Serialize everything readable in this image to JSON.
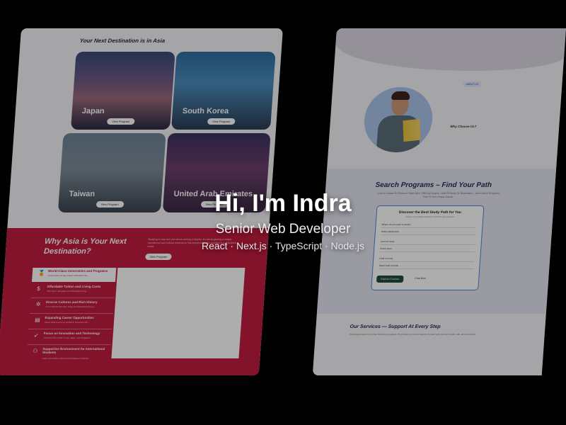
{
  "hero": {
    "title": "Hi, I'm Indra",
    "role": "Senior Web Developer",
    "stack": "React · Next.js · TypeScript · Node.js"
  },
  "left_mockup": {
    "section_title": "Your Next Destination is in Asia",
    "destinations": [
      {
        "name": "Japan",
        "button": "View Program"
      },
      {
        "name": "South Korea",
        "button": "View Program"
      },
      {
        "name": "Taiwan",
        "button": "View Program"
      },
      {
        "name": "United Arab Emirates",
        "button": "View Program"
      }
    ],
    "why": {
      "title": "Why Asia is Your Next Destination?",
      "description": "Studying in Asia isn't just about earning a degree, it's about gaining a unique educational and cultural experience that prepares you for success in a globalized world.",
      "button": "View Program",
      "features": [
        {
          "title": "World-Class Universities and Programs",
          "sub": "Asia is home to top-ranked institutions like..."
        },
        {
          "title": "Affordable Tuition and Living Costs",
          "sub": "With lower education and affordable living..."
        },
        {
          "title": "Diverse Cultures and Rich History",
          "sub": "From vibrant cities like Tokyo and beautiful scenery..."
        },
        {
          "title": "Expanding Career Opportunities",
          "sub": "Asia's rapid economic growth in industries like..."
        },
        {
          "title": "Focus on Innovation and Technology",
          "sub": "Countries like South Korea, Japan, and Singapore..."
        },
        {
          "title": "Supportive Environment for International Students",
          "sub": "Asian universities welcome international students..."
        }
      ]
    }
  },
  "right_mockup": {
    "about_badge": "ABOUT US",
    "why_choose": "Why Choose Us?",
    "search": {
      "title": "Search Programs – Find Your Path",
      "subtitle": "Lost In A Maze Of Choices? Start Here. Filter By Degree, Field Of Study Or Destination – And Unlock Programs That Fit Your Dream Career."
    },
    "form": {
      "title": "Discover the Best Study Path for You",
      "subtitle": "Answer a few simple questions to find the right program",
      "fields": [
        "Where do you want to study?",
        "Select destination",
        "Level of study",
        "Select level",
        "Field of study",
        "Select field of study"
      ],
      "explore_button": "Explore Courses",
      "chat_button": "Chat Now"
    },
    "services": {
      "title": "Our Services — Support At Every Step",
      "subtitle": "Studying abroad is more than choosing a program. We provide end-to-end support to make your journey smooth, safe, and successful."
    }
  },
  "colors": {
    "background": "#000000",
    "accent_red": "#c21d3f",
    "accent_green": "#1f4d3a",
    "form_border": "#4a86d8"
  }
}
